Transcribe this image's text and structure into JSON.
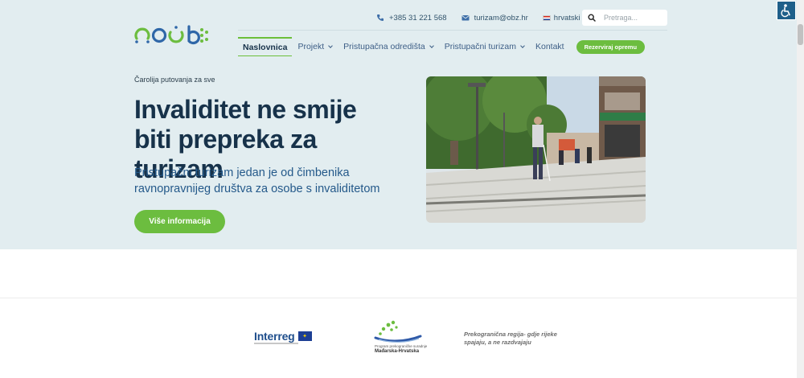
{
  "header": {
    "logo_alt": "obz logo",
    "phone": "+385 31 221 568",
    "email": "turizam@obz.hr",
    "language": "hrvatski",
    "search_placeholder": "Pretraga..."
  },
  "nav": {
    "items": [
      {
        "label": "Naslovnica",
        "active": true,
        "dropdown": false
      },
      {
        "label": "Projekt",
        "active": false,
        "dropdown": true
      },
      {
        "label": "Pristupačna odredišta",
        "active": false,
        "dropdown": true
      },
      {
        "label": "Pristupačni turizam",
        "active": false,
        "dropdown": true
      },
      {
        "label": "Kontakt",
        "active": false,
        "dropdown": false
      }
    ],
    "cta_label": "Rezerviraj opremu"
  },
  "hero": {
    "eyebrow": "Čarolija putovanja za sve",
    "title": "Invaliditet ne smije biti prepreka za turizam",
    "subtitle": "Pristupačni turizam jedan je od čimbenika ravnopravnijeg društva za osobe s invaliditetom",
    "button_label": "Više informacija"
  },
  "partners": {
    "interreg_name": "Interreg",
    "program_line1": "Program prekograničke suradnje",
    "program_line2": "Mađarska-Hrvatska",
    "tagline": "Prekogranična regija- gdje rijeke spajaju, a ne razdvajaju"
  },
  "colors": {
    "hero_bg": "#e2edf0",
    "navy": "#17324a",
    "link_blue": "#3d5e86",
    "accent_green": "#6cbd3f",
    "a11y_blue": "#1e5f8a"
  },
  "icons": [
    "phone-icon",
    "mail-icon",
    "flag-icon",
    "search-icon",
    "chevron-down-icon",
    "accessibility-icon"
  ]
}
